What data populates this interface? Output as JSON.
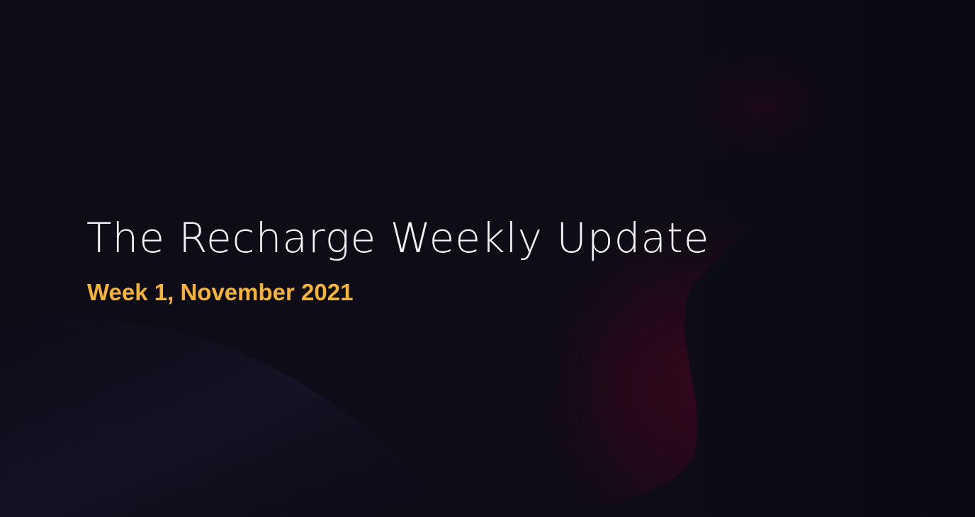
{
  "banner": {
    "title": "The Recharge Weekly Update",
    "subtitle": "Week 1, November 2021"
  },
  "colors": {
    "background": "#0c0b15",
    "title": "#f4f4f6",
    "accent": "#f5b335",
    "glow": "#4a0522"
  }
}
